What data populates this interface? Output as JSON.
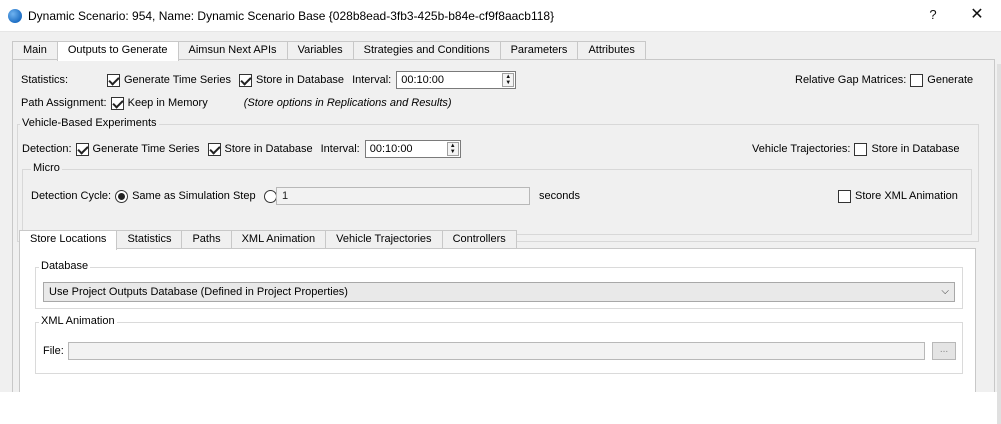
{
  "window": {
    "title": "Dynamic Scenario: 954, Name: Dynamic Scenario Base {028b8ead-3fb3-425b-b84e-cf9f8aacb118}",
    "help_label": "?",
    "close_label": "✕"
  },
  "top_tabs": [
    "Main",
    "Outputs to Generate",
    "Aimsun Next APIs",
    "Variables",
    "Strategies and Conditions",
    "Parameters",
    "Attributes"
  ],
  "active_top_tab": "Outputs to Generate",
  "statistics": {
    "label": "Statistics:",
    "generate_time_series": "Generate Time Series",
    "generate_time_series_checked": true,
    "store_in_database": "Store in Database",
    "store_in_database_checked": true,
    "interval_label": "Interval:",
    "interval_value": "00:10:00"
  },
  "relative_gap": {
    "label": "Relative Gap Matrices:",
    "generate": "Generate",
    "generate_checked": false
  },
  "path_assignment": {
    "label": "Path Assignment:",
    "keep_in_memory": "Keep in Memory",
    "keep_in_memory_checked": true,
    "note": "(Store options in Replications and Results)"
  },
  "vehicle_based": {
    "title": "Vehicle-Based Experiments",
    "detection_label": "Detection:",
    "generate_time_series": "Generate Time Series",
    "generate_time_series_checked": true,
    "store_in_database": "Store in Database",
    "store_in_database_checked": true,
    "interval_label": "Interval:",
    "interval_value": "00:10:00",
    "trajectories_label": "Vehicle Trajectories:",
    "trajectories_store": "Store in Database",
    "trajectories_store_checked": false,
    "micro": {
      "title": "Micro",
      "detection_cycle_label": "Detection Cycle:",
      "same_as_step": "Same as Simulation Step",
      "same_as_step_selected": true,
      "custom_value": "1",
      "seconds_label": "seconds",
      "store_xml": "Store XML Animation",
      "store_xml_checked": false
    }
  },
  "bottom_tabs": [
    "Store Locations",
    "Statistics",
    "Paths",
    "XML Animation",
    "Vehicle Trajectories",
    "Controllers"
  ],
  "active_bottom_tab": "Store Locations",
  "store_locations": {
    "database_title": "Database",
    "database_value": "Use Project Outputs Database (Defined in Project Properties)",
    "xml_title": "XML Animation",
    "file_label": "File:",
    "file_value": "",
    "browse_label": "..."
  },
  "colors": {
    "window_bg": "#f0f0f0",
    "active_tab_bg": "#ffffff",
    "border": "#c8c8c8"
  }
}
